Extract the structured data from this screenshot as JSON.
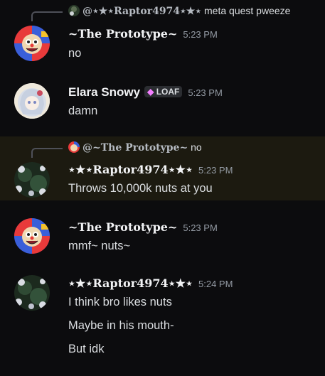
{
  "messages": [
    {
      "reply": {
        "name": "@⋆★⋆Raptor4974⋆★⋆",
        "text": "meta quest pweeze"
      },
      "author": "~The Prototype~",
      "time": "5:23 PM",
      "lines": [
        "no"
      ],
      "avatar": "clown-avatar"
    },
    {
      "author": "Elara Snowy",
      "badge": {
        "icon": "gem-icon",
        "label": "LOAF"
      },
      "time": "5:23 PM",
      "lines": [
        "damn"
      ],
      "avatar": "anime-avatar"
    },
    {
      "reply": {
        "name": "@~The Prototype~",
        "text": "no"
      },
      "author": "⋆★⋆Raptor4974⋆★⋆",
      "time": "5:23 PM",
      "lines": [
        "Throws 10,000k nuts at you"
      ],
      "avatar": "flowers-avatar",
      "highlighted": true
    },
    {
      "author": "~The Prototype~",
      "time": "5:23 PM",
      "lines": [
        "mmf~ nuts~"
      ],
      "avatar": "clown-avatar"
    },
    {
      "author": "⋆★⋆Raptor4974⋆★⋆",
      "time": "5:24 PM",
      "lines": [
        "I think bro likes nuts",
        "Maybe in his mouth-",
        "But idk"
      ],
      "avatar": "flowers-avatar"
    }
  ]
}
